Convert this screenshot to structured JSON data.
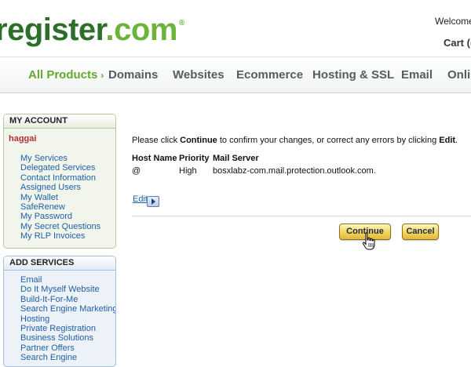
{
  "header": {
    "logo_main": "register",
    "logo_dot": ".com",
    "logo_reg": "®",
    "welcome": "Welcome",
    "cart": "Cart (("
  },
  "nav": {
    "items": [
      {
        "label": "All Products",
        "icon": "chevron-right-icon",
        "active": true
      },
      {
        "label": "Domains"
      },
      {
        "label": "Websites"
      },
      {
        "label": "Ecommerce"
      },
      {
        "label": "Hosting & SSL"
      },
      {
        "label": "Email"
      },
      {
        "label": "Onlin"
      }
    ]
  },
  "sidebar": {
    "account": {
      "title": "MY ACCOUNT",
      "username": "haggai",
      "links": [
        "My Services",
        "Delegated Services",
        "Contact Information",
        "Assigned Users",
        "My Wallet",
        "SafeRenew",
        "My Password",
        "My Secret Questions",
        "My RLP Invoices"
      ]
    },
    "add_services": {
      "title": "ADD SERVICES",
      "links": [
        "Email",
        "Do It Myself Website",
        "Build-It-For-Me",
        "Search Engine Marketing",
        "Hosting",
        "Private Registration",
        "Business Solutions",
        "Partner Offers",
        "Search Engine"
      ]
    }
  },
  "main": {
    "instruction": {
      "part1": "Please click ",
      "bold1": "Continue",
      "part2": " to confirm your changes, or correct any errors by clicking ",
      "bold2": "Edit",
      "part3": "."
    },
    "table": {
      "headers": [
        "Host Name",
        "Priority",
        "Mail Server"
      ],
      "rows": [
        [
          "@",
          "High",
          "bosxlabz-com.mail.protection.outlook.com."
        ]
      ]
    },
    "edit_label": "Edit",
    "continue_label": "Continue",
    "cancel_label": "Cancel"
  },
  "colors": {
    "brand_green": "#2b6f2a",
    "accent_green": "#65a830",
    "link_blue": "#1f5fa6",
    "username_red": "#b03030",
    "button_gold": "#f3d55a"
  }
}
